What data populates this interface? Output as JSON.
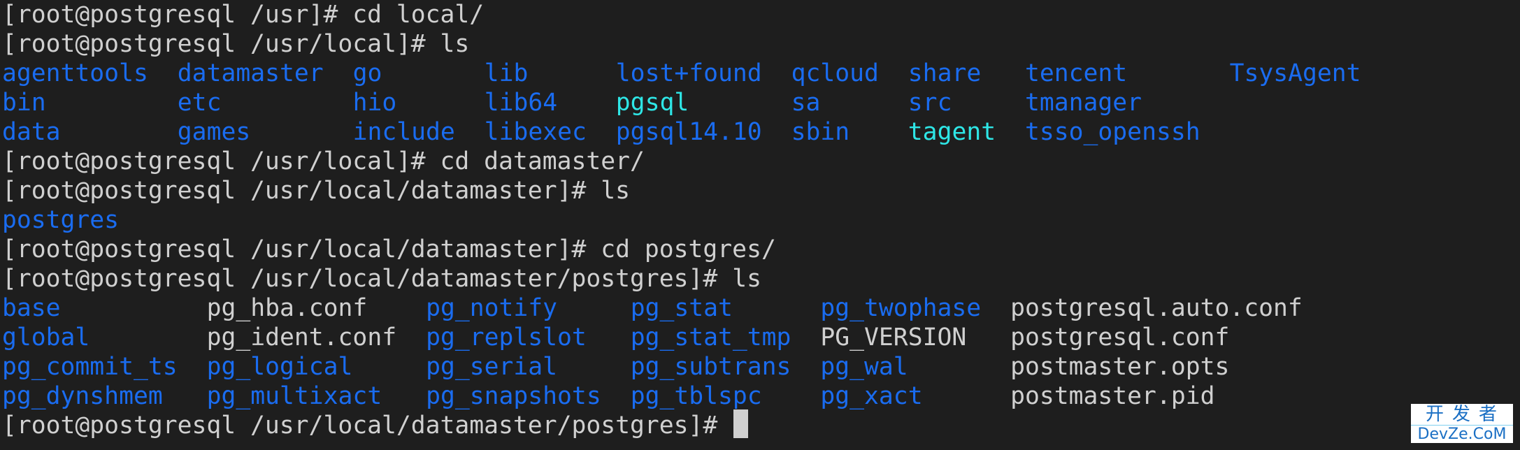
{
  "terminal": {
    "prompts": [
      {
        "prompt": "[root@postgresql /usr]# ",
        "command": "cd local/"
      },
      {
        "prompt": "[root@postgresql /usr/local]# ",
        "command": "ls"
      },
      {
        "prompt": "[root@postgresql /usr/local]# ",
        "command": "cd datamaster/"
      },
      {
        "prompt": "[root@postgresql /usr/local/datamaster]# ",
        "command": "ls"
      },
      {
        "prompt": "[root@postgresql /usr/local/datamaster]# ",
        "command": "cd postgres/"
      },
      {
        "prompt": "[root@postgresql /usr/local/datamaster/postgres]# ",
        "command": "ls"
      },
      {
        "prompt": "[root@postgresql /usr/local/datamaster/postgres]# ",
        "command": ""
      }
    ],
    "ls_usr_local": [
      [
        {
          "name": "agenttools",
          "type": "dir"
        },
        {
          "name": "datamaster",
          "type": "dir"
        },
        {
          "name": "go",
          "type": "dir"
        },
        {
          "name": "lib",
          "type": "dir"
        },
        {
          "name": "lost+found",
          "type": "dir"
        },
        {
          "name": "qcloud",
          "type": "dir"
        },
        {
          "name": "share",
          "type": "dir"
        },
        {
          "name": "tencent",
          "type": "dir"
        },
        {
          "name": "TsysAgent",
          "type": "dir"
        }
      ],
      [
        {
          "name": "bin",
          "type": "dir"
        },
        {
          "name": "etc",
          "type": "dir"
        },
        {
          "name": "hio",
          "type": "dir"
        },
        {
          "name": "lib64",
          "type": "dir"
        },
        {
          "name": "pgsql",
          "type": "link"
        },
        {
          "name": "sa",
          "type": "dir"
        },
        {
          "name": "src",
          "type": "dir"
        },
        {
          "name": "tmanager",
          "type": "dir"
        }
      ],
      [
        {
          "name": "data",
          "type": "dir"
        },
        {
          "name": "games",
          "type": "dir"
        },
        {
          "name": "include",
          "type": "dir"
        },
        {
          "name": "libexec",
          "type": "dir"
        },
        {
          "name": "pgsql14.10",
          "type": "dir"
        },
        {
          "name": "sbin",
          "type": "dir"
        },
        {
          "name": "tagent",
          "type": "link"
        },
        {
          "name": "tsso_openssh",
          "type": "dir"
        }
      ]
    ],
    "ls_datamaster": [
      [
        {
          "name": "postgres",
          "type": "dir"
        }
      ]
    ],
    "ls_postgres": [
      [
        {
          "name": "base",
          "type": "dir"
        },
        {
          "name": "pg_hba.conf",
          "type": "file"
        },
        {
          "name": "pg_notify",
          "type": "dir"
        },
        {
          "name": "pg_stat",
          "type": "dir"
        },
        {
          "name": "pg_twophase",
          "type": "dir"
        },
        {
          "name": "postgresql.auto.conf",
          "type": "file"
        }
      ],
      [
        {
          "name": "global",
          "type": "dir"
        },
        {
          "name": "pg_ident.conf",
          "type": "file"
        },
        {
          "name": "pg_replslot",
          "type": "dir"
        },
        {
          "name": "pg_stat_tmp",
          "type": "dir"
        },
        {
          "name": "PG_VERSION",
          "type": "file"
        },
        {
          "name": "postgresql.conf",
          "type": "file"
        }
      ],
      [
        {
          "name": "pg_commit_ts",
          "type": "dir"
        },
        {
          "name": "pg_logical",
          "type": "dir"
        },
        {
          "name": "pg_serial",
          "type": "dir"
        },
        {
          "name": "pg_subtrans",
          "type": "dir"
        },
        {
          "name": "pg_wal",
          "type": "dir"
        },
        {
          "name": "postmaster.opts",
          "type": "file"
        }
      ],
      [
        {
          "name": "pg_dynshmem",
          "type": "dir"
        },
        {
          "name": "pg_multixact",
          "type": "dir"
        },
        {
          "name": "pg_snapshots",
          "type": "dir"
        },
        {
          "name": "pg_tblspc",
          "type": "dir"
        },
        {
          "name": "pg_xact",
          "type": "dir"
        },
        {
          "name": "postmaster.pid",
          "type": "file"
        }
      ]
    ],
    "colors": {
      "background": "#1e1e1e",
      "text": "#d0d0d0",
      "directory": "#1a6cf0",
      "symlink": "#2ee6e6"
    }
  },
  "watermark": {
    "line1": "开发者",
    "line2": "DevZe.CoM"
  }
}
